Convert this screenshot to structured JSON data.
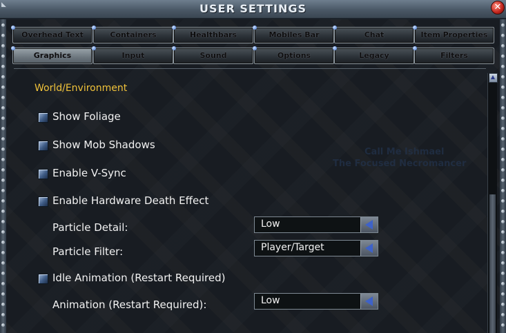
{
  "window": {
    "title": "USER SETTINGS",
    "close_glyph": "✕"
  },
  "tabs_row1": [
    {
      "label": "Overhead Text"
    },
    {
      "label": "Containers"
    },
    {
      "label": "Healthbars"
    },
    {
      "label": "Mobiles Bar"
    },
    {
      "label": "Chat"
    },
    {
      "label": "Item Properties"
    }
  ],
  "tabs_row2": [
    {
      "label": "Graphics",
      "active": true
    },
    {
      "label": "Input"
    },
    {
      "label": "Sound"
    },
    {
      "label": "Options"
    },
    {
      "label": "Legacy"
    },
    {
      "label": "Filters"
    }
  ],
  "background_overlay": {
    "line1": "Call Me Ishmael",
    "line2": "The Focused Necromancer"
  },
  "section": {
    "title": "World/Environment"
  },
  "options": [
    {
      "label": "Show Foliage",
      "checked": true
    },
    {
      "label": "Show Mob Shadows",
      "checked": true
    },
    {
      "label": "Enable V-Sync",
      "checked": true
    },
    {
      "label": "Enable Hardware Death Effect",
      "checked": true
    }
  ],
  "particle_detail": {
    "label": "Particle Detail:",
    "value": "Low"
  },
  "particle_filter": {
    "label": "Particle Filter:",
    "value": "Player/Target"
  },
  "idle_animation": {
    "label": "Idle Animation (Restart Required)",
    "checked": true
  },
  "animation": {
    "label": "Animation (Restart Required):",
    "value": "Low"
  },
  "colors": {
    "section_title": "#f0c23a",
    "text": "#f2f2f2",
    "arrow": "#3e62c8"
  },
  "icons": {
    "close": "close-icon",
    "checkbox": "checkbox-checked-icon",
    "dropdown_arrow": "triangle-left-icon",
    "scroll_up": "chevron-up-icon"
  }
}
